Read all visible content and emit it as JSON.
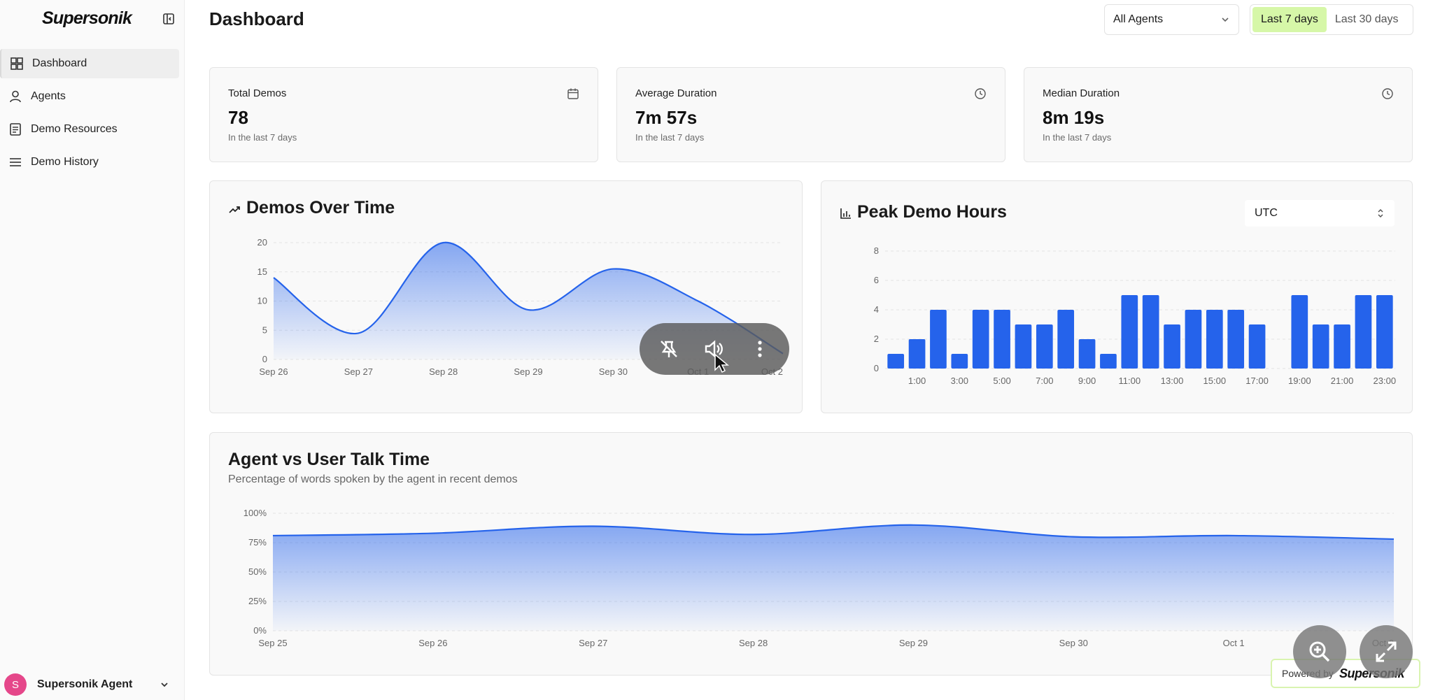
{
  "sidebar": {
    "logo": "Supersonik",
    "items": [
      {
        "label": "Dashboard",
        "icon": "dashboard-icon",
        "active": true
      },
      {
        "label": "Agents",
        "icon": "user-icon",
        "active": false
      },
      {
        "label": "Demo Resources",
        "icon": "document-icon",
        "active": false
      },
      {
        "label": "Demo History",
        "icon": "list-icon",
        "active": false
      }
    ],
    "user": {
      "initial": "S",
      "name": "Supersonik Agent"
    }
  },
  "header": {
    "title": "Dashboard",
    "agent_filter": "All Agents",
    "ranges": [
      "Last 7 days",
      "Last 30 days"
    ],
    "active_range": "Last 7 days"
  },
  "stats": [
    {
      "label": "Total Demos",
      "value": "78",
      "sub": "In the last 7 days",
      "icon": "calendar-icon"
    },
    {
      "label": "Average Duration",
      "value": "7m 57s",
      "sub": "In the last 7 days",
      "icon": "clock-icon"
    },
    {
      "label": "Median Duration",
      "value": "8m 19s",
      "sub": "In the last 7 days",
      "icon": "clock-icon"
    }
  ],
  "demos_over_time": {
    "title": "Demos Over Time"
  },
  "peak_hours": {
    "title": "Peak Demo Hours",
    "timezone": "UTC"
  },
  "talk_time": {
    "title": "Agent vs User Talk Time",
    "subtitle": "Percentage of words spoken by the agent in recent demos"
  },
  "powered_by": {
    "prefix": "Powered by",
    "brand": "Supersonik"
  },
  "colors": {
    "accent": "#2563eb",
    "active_range_bg": "#d6f7a8",
    "avatar": "#e5478a"
  },
  "chart_data": [
    {
      "type": "area",
      "title": "Demos Over Time",
      "categories": [
        "Sep 26",
        "Sep 27",
        "Sep 28",
        "Sep 29",
        "Sep 30",
        "Oct 1",
        "Oct 2"
      ],
      "values": [
        14,
        4.5,
        20,
        8.5,
        15.5,
        10,
        1
      ],
      "yticks": [
        0,
        5,
        10,
        15,
        20
      ],
      "ylim": [
        0,
        20
      ]
    },
    {
      "type": "bar",
      "title": "Peak Demo Hours",
      "categories": [
        "0:00",
        "1:00",
        "2:00",
        "3:00",
        "4:00",
        "5:00",
        "6:00",
        "7:00",
        "8:00",
        "9:00",
        "10:00",
        "11:00",
        "12:00",
        "13:00",
        "14:00",
        "15:00",
        "16:00",
        "17:00",
        "18:00",
        "19:00",
        "20:00",
        "21:00",
        "22:00",
        "23:00"
      ],
      "xtick_labels": [
        "1:00",
        "3:00",
        "5:00",
        "7:00",
        "9:00",
        "11:00",
        "13:00",
        "15:00",
        "17:00",
        "19:00",
        "21:00",
        "23:00"
      ],
      "values": [
        1,
        2,
        4,
        1,
        4,
        4,
        3,
        3,
        4,
        2,
        1,
        5,
        5,
        3,
        4,
        4,
        4,
        3,
        0,
        5,
        3,
        3,
        5,
        5
      ],
      "yticks": [
        0,
        2,
        4,
        6,
        8
      ],
      "ylim": [
        0,
        8
      ]
    },
    {
      "type": "area",
      "title": "Agent vs User Talk Time",
      "categories": [
        "Sep 25",
        "Sep 26",
        "Sep 27",
        "Sep 28",
        "Sep 29",
        "Sep 30",
        "Oct 1",
        "Oct 2"
      ],
      "values": [
        81,
        83,
        89,
        82,
        90,
        80,
        81,
        78
      ],
      "yticks": [
        "0%",
        "25%",
        "50%",
        "75%",
        "100%"
      ],
      "ylim": [
        0,
        100
      ]
    }
  ]
}
